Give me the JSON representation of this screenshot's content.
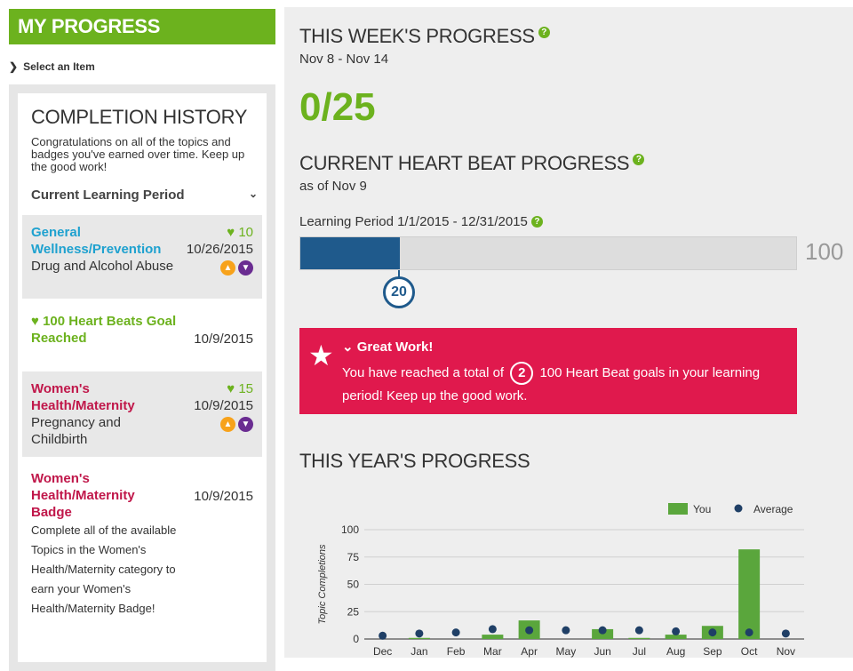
{
  "left": {
    "header": "MY PROGRESS",
    "select_item": "Select an Item",
    "history": {
      "title": "COMPLETION HISTORY",
      "desc": "Congratulations on all of the topics and badges you've earned over time. Keep up the good work!",
      "period": "Current Learning Period",
      "items": [
        {
          "title": "General Wellness/Prevention",
          "subtitle": "Drug and Alcohol Abuse",
          "points": "10",
          "date": "10/26/2015"
        },
        {
          "title": "100 Heart Beats Goal Reached",
          "date": "10/9/2015"
        },
        {
          "title": "Women's Health/Maternity",
          "subtitle": "Pregnancy and Childbirth",
          "points": "15",
          "date": "10/9/2015"
        },
        {
          "title": "Women's Health/Maternity Badge",
          "subtitle": "Complete all of the available Topics in the Women's Health/Maternity category to earn your Women's Health/Maternity Badge!",
          "date": "10/9/2015"
        }
      ]
    }
  },
  "week": {
    "title": "THIS WEEK'S PROGRESS",
    "range": "Nov 8 - Nov 14",
    "score": "0/25"
  },
  "heart": {
    "title": "CURRENT HEART BEAT PROGRESS",
    "as_of": "as of Nov 9",
    "period": "Learning Period 1/1/2015 - 12/31/2015",
    "value": 20,
    "value_label": "20",
    "max": 100,
    "max_label": "100"
  },
  "alert": {
    "title": "Great Work!",
    "pre": "You have reached a total of",
    "count": "2",
    "post": "100 Heart Beat goals in your learning period! Keep up the good work."
  },
  "year": {
    "title": "THIS YEAR'S PROGRESS"
  },
  "colors": {
    "green": "#6cb21e",
    "navy": "#1f5a8c",
    "alert": "#e0194d",
    "bar": "#5aa63c"
  },
  "chart_data": {
    "type": "bar",
    "categories": [
      "Dec",
      "Jan",
      "Feb",
      "Mar",
      "Apr",
      "May",
      "Jun",
      "Jul",
      "Aug",
      "Sep",
      "Oct",
      "Nov"
    ],
    "ylabel": "Topic Completions",
    "ylim": [
      0,
      100
    ],
    "yticks": [
      0,
      25,
      50,
      75,
      100
    ],
    "legend_position": "top-right",
    "series": [
      {
        "name": "You",
        "kind": "bar",
        "values": [
          0,
          1,
          0,
          4,
          17,
          0,
          9,
          1,
          4,
          12,
          82,
          0
        ]
      },
      {
        "name": "Average",
        "kind": "point",
        "values": [
          3,
          5,
          6,
          9,
          8,
          8,
          8,
          8,
          7,
          6,
          6,
          5
        ]
      }
    ],
    "grid": true
  }
}
